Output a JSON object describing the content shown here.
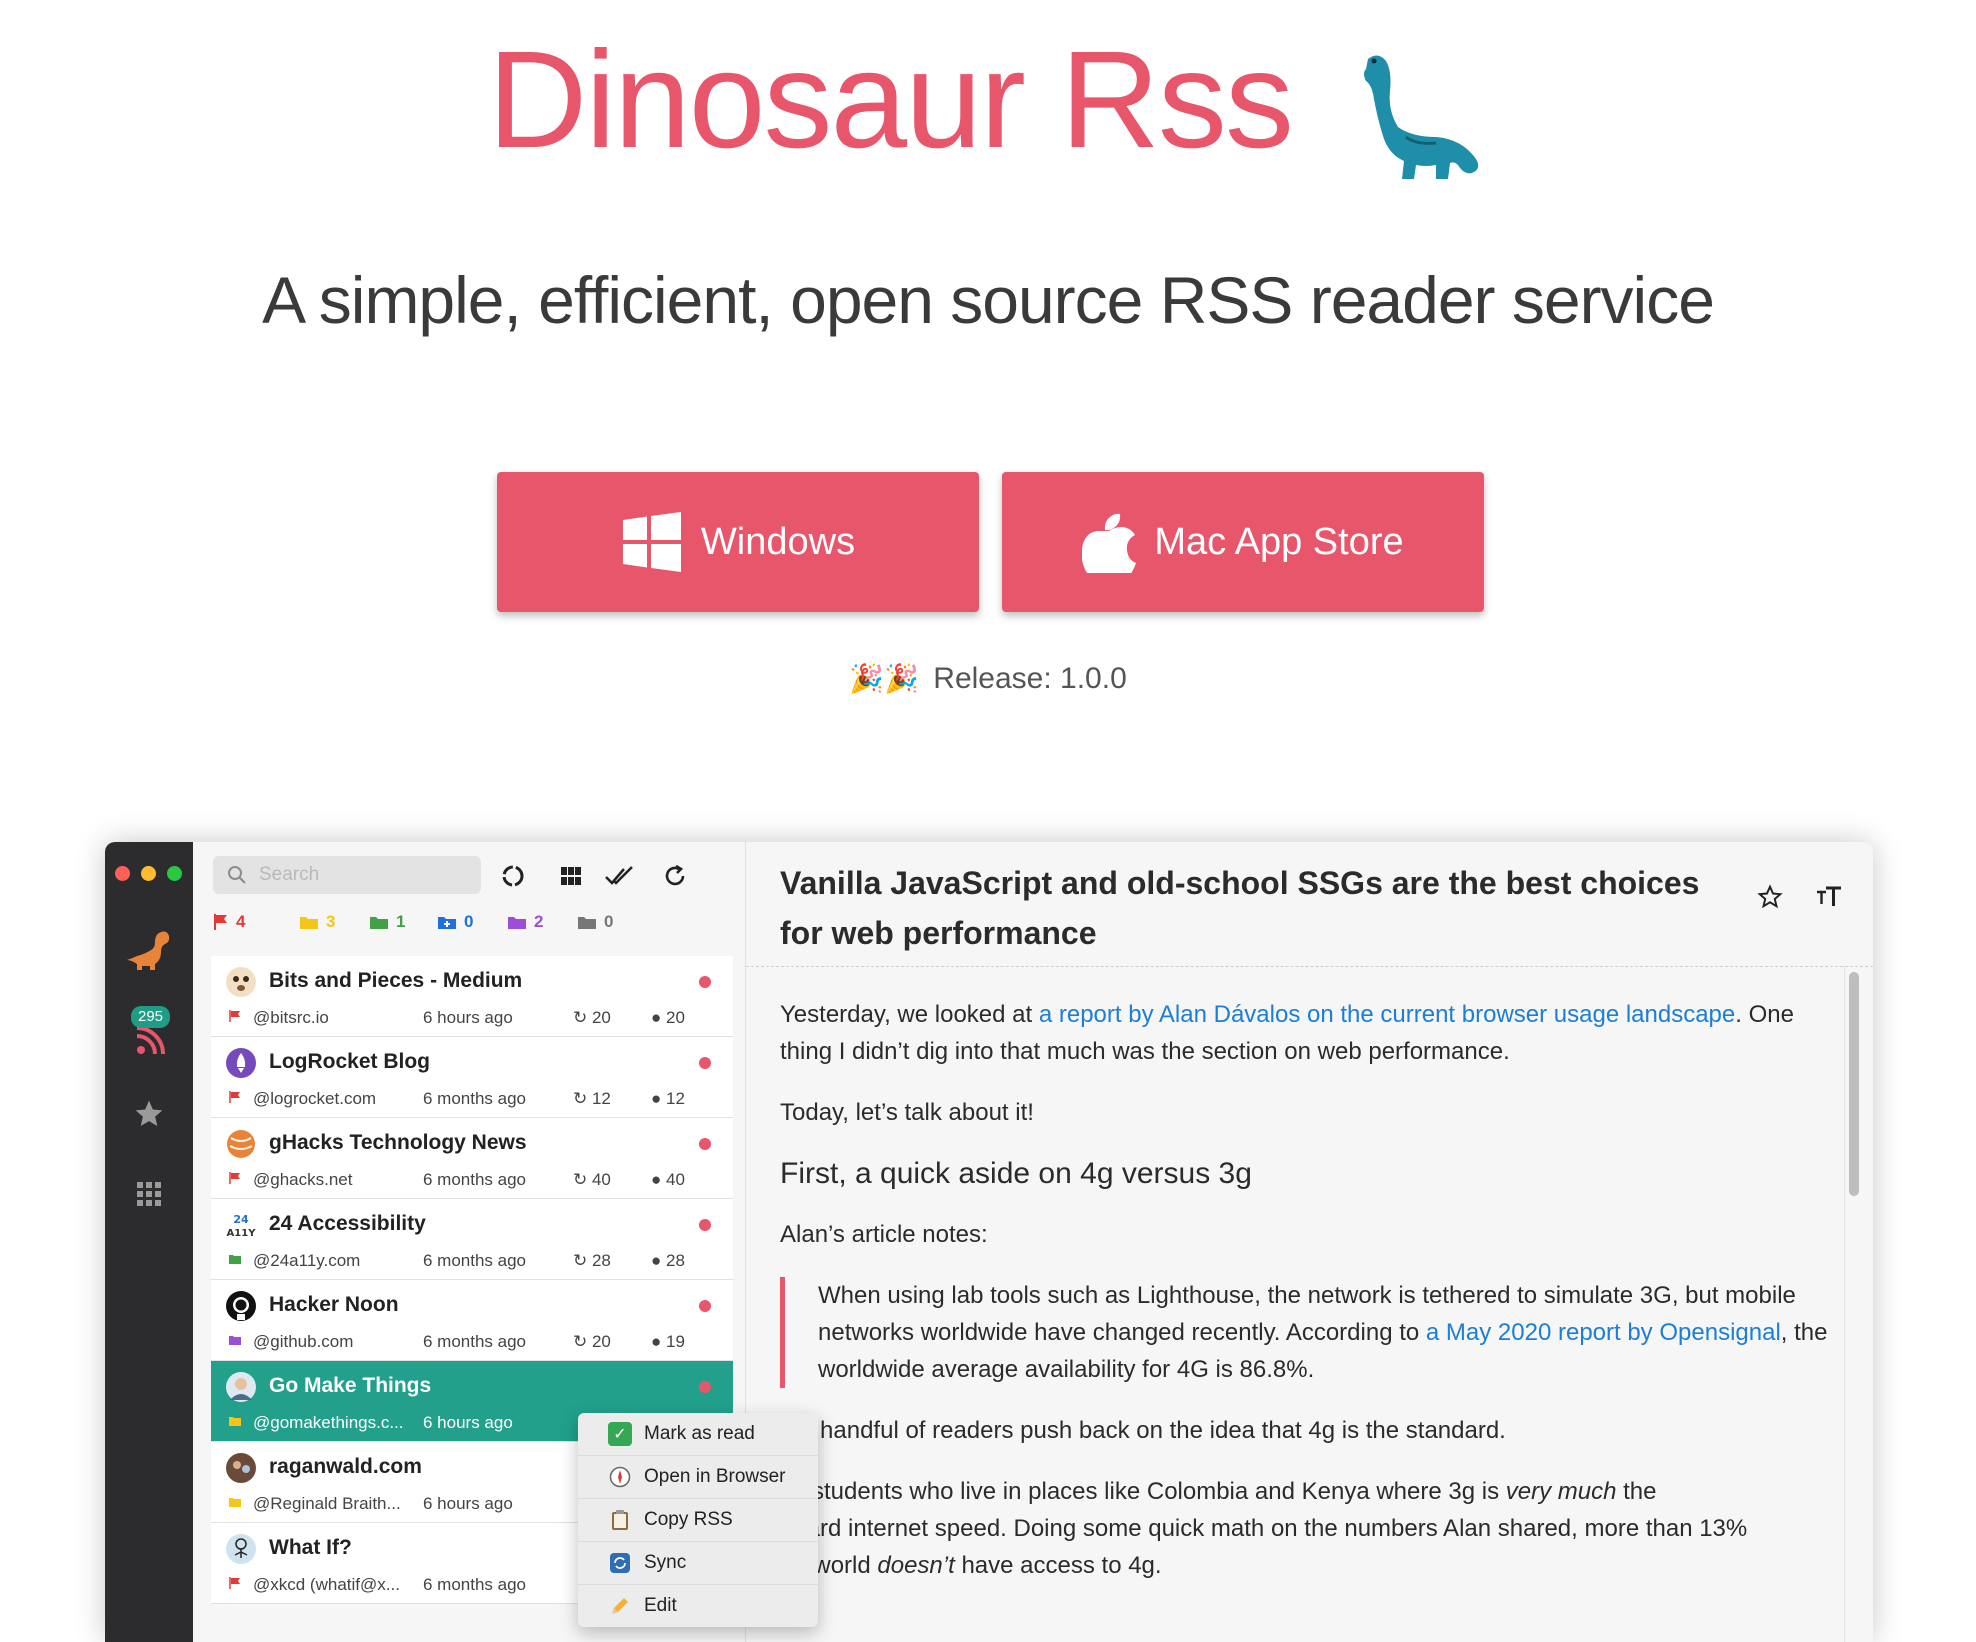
{
  "hero": {
    "title": "Dinosaur Rss",
    "tagline": "A simple, efficient, open source RSS reader service",
    "windows_label": "Windows",
    "mac_label": "Mac App Store",
    "release": "Release: 1.0.0",
    "brand_color": "#e8566b"
  },
  "app": {
    "dock": {
      "unread_badge": "295"
    },
    "search": {
      "placeholder": "Search"
    },
    "filters": [
      {
        "icon": "flag-icon",
        "count": "4",
        "color": "#e53935"
      },
      {
        "icon": "folder-star-icon",
        "count": "3",
        "color": "#f5c518"
      },
      {
        "icon": "folder-person-icon",
        "count": "1",
        "color": "#43a047"
      },
      {
        "icon": "folder-plus-icon",
        "count": "0",
        "color": "#1e6fe0"
      },
      {
        "icon": "folder-icon",
        "count": "2",
        "color": "#9c4fd6"
      },
      {
        "icon": "folder-icon",
        "count": "0",
        "color": "#777777"
      }
    ],
    "feeds": [
      {
        "name": "Bits and Pieces - Medium",
        "handle": "@bitsrc.io",
        "time": "6 hours ago",
        "refresh": "20",
        "unread": "20",
        "tag": "#e53935"
      },
      {
        "name": "LogRocket Blog",
        "handle": "@logrocket.com",
        "time": "6 months ago",
        "refresh": "12",
        "unread": "12",
        "tag": "#e53935"
      },
      {
        "name": "gHacks Technology News",
        "handle": "@ghacks.net",
        "time": "6 months ago",
        "refresh": "40",
        "unread": "40",
        "tag": "#e53935"
      },
      {
        "name": "24 Accessibility",
        "handle": "@24a11y.com",
        "time": "6 months ago",
        "refresh": "28",
        "unread": "28",
        "tag": "#43a047"
      },
      {
        "name": "Hacker Noon",
        "handle": "@github.com",
        "time": "6 months ago",
        "refresh": "20",
        "unread": "19",
        "tag": "#9c4fd6"
      },
      {
        "name": "Go Make Things",
        "handle": "@gomakethings.c...",
        "time": "6 hours ago",
        "refresh": "",
        "unread": "",
        "tag": "#f5c518"
      },
      {
        "name": "raganwald.com",
        "handle": "@Reginald Braith...",
        "time": "6 hours ago",
        "refresh": "",
        "unread": "",
        "tag": "#f5c518"
      },
      {
        "name": "What If?",
        "handle": "@xkcd (whatif@x...",
        "time": "6 months ago",
        "refresh": "",
        "unread": "",
        "tag": "#e53935"
      }
    ],
    "context_menu": [
      "Mark as read",
      "Open in Browser",
      "Copy RSS",
      "Sync",
      "Edit"
    ],
    "article": {
      "title": "Vanilla JavaScript and old-school SSGs are the best choices for web performance",
      "p1_before": "Yesterday, we looked at ",
      "p1_link": "a report by Alan Dávalos on the current browser usage landscape",
      "p1_after": ". One thing I didn’t dig into that much was the section on web performance.",
      "p2": "Today, let’s talk about it!",
      "h2": "First, a quick aside on 4g versus 3g",
      "p3": "Alan’s article notes:",
      "q_before": "When using lab tools such as Lighthouse, the network is tethered to simulate 3G, but mobile networks worldwide have changed recently. According to ",
      "q_link": "a May 2020 report by Opensignal",
      "q_after": ", the worldwide average availability for 4G is 86.8%.",
      "p4": "d a handful of readers push back on the idea that 4g is the standard.",
      "p5_a": "ve students who live in places like Colombia and Kenya where 3g is ",
      "p5_em": "very much",
      "p5_b": " the",
      "p6": "ndard internet speed. Doing some quick math on the numbers Alan shared, more than 13%",
      "p7_a": "he world ",
      "p7_em": "doesn’t",
      "p7_b": " have access to 4g."
    }
  }
}
